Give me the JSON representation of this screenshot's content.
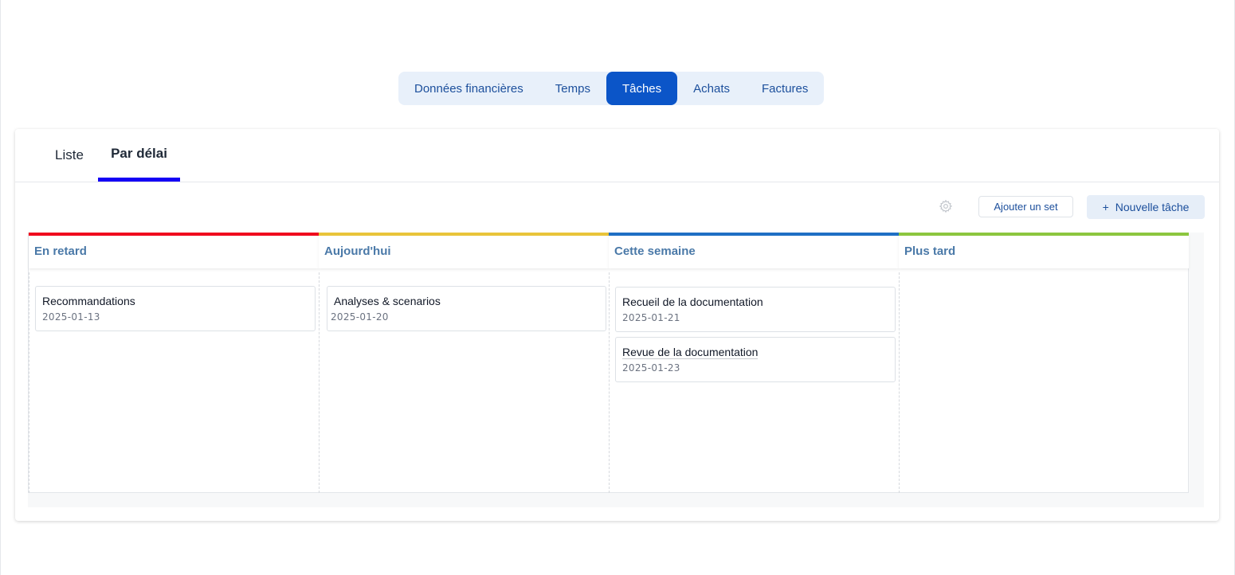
{
  "top_tabs": [
    {
      "label": "Données financières",
      "active": false
    },
    {
      "label": "Temps",
      "active": false
    },
    {
      "label": "Tâches",
      "active": true
    },
    {
      "label": "Achats",
      "active": false
    },
    {
      "label": "Factures",
      "active": false
    }
  ],
  "sub_tabs": {
    "list_label": "Liste",
    "deadline_label": "Par délai",
    "active": "deadline"
  },
  "toolbar": {
    "settings_icon": "gear-icon",
    "add_set_label": "Ajouter un set",
    "new_task_plus": "+",
    "new_task_label": "Nouvelle tâche"
  },
  "columns": [
    {
      "title": "En retard",
      "color": "#f00a1e",
      "tasks": [
        {
          "title": "Recommandations",
          "date": "2025-01-13"
        }
      ]
    },
    {
      "title": "Aujourd'hui",
      "color": "#e9c43a",
      "tasks": [
        {
          "title": "Analyses & scenarios",
          "date": "2025-01-20"
        }
      ]
    },
    {
      "title": "Cette semaine",
      "color": "#1f6fc4",
      "tasks": [
        {
          "title": "Recueil de la documentation",
          "date": "2025-01-21"
        },
        {
          "title": "Revue de la documentation",
          "date": "2025-01-23"
        }
      ]
    },
    {
      "title": "Plus tard",
      "color": "#8cc63f",
      "tasks": []
    }
  ]
}
